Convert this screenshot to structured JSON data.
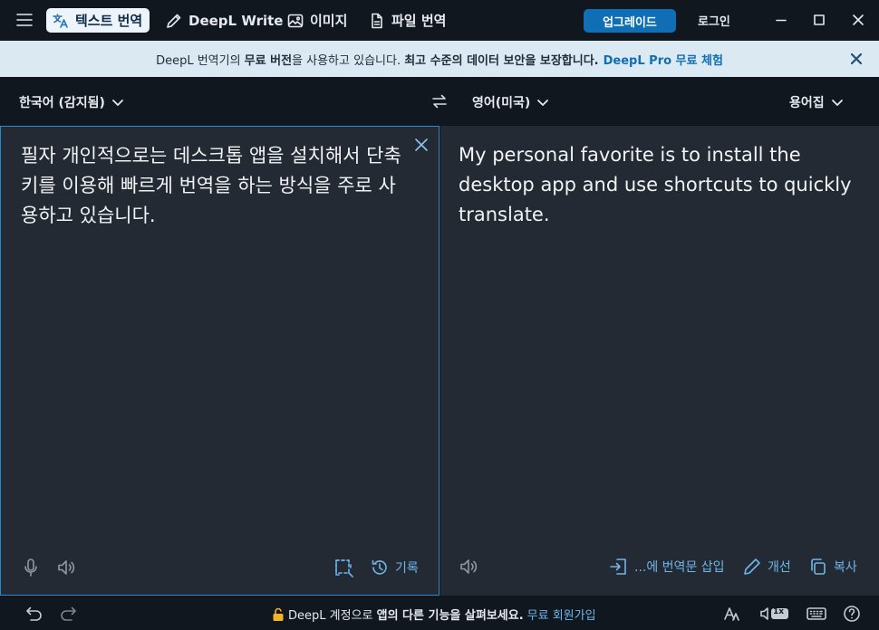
{
  "titlebar": {
    "tabs": [
      {
        "label": "텍스트 번역",
        "icon": "translate-icon",
        "active": true
      },
      {
        "label": "DeepL Write",
        "icon": "pen-icon"
      },
      {
        "label": "이미지",
        "icon": "image-icon"
      },
      {
        "label": "파일 번역",
        "icon": "file-icon"
      }
    ],
    "upgrade_label": "업그레이드",
    "login_label": "로그인"
  },
  "banner": {
    "text_1": "DeepL 번역기의 ",
    "bold_1": "무료 버전",
    "text_2": "을 사용하고 있습니다. ",
    "bold_2": "최고 수준의 데이터 보안을 보장합니다.",
    "link": "DeepL Pro 무료 체험"
  },
  "source": {
    "language": "한국어 (감지됨)",
    "text": "필자 개인적으로는 데스크톱 앱을 설치해서 단축키를 이용해 빠르게 번역을 하는 방식을 주로 사용하고 있습니다.",
    "history_label": "기록"
  },
  "target": {
    "language": "영어(미국)",
    "glossary_label": "용어집",
    "text": "My personal favorite is to install the desktop app and use shortcuts to quickly translate.",
    "insert_label": "...에 번역문 삽입",
    "improve_label": "개선",
    "copy_label": "복사"
  },
  "footer": {
    "msg_1": "DeepL 계정으로 ",
    "msg_bold": "앱의 다른 기능을 살펴보세요.",
    "link": "무료 회원가입",
    "speed_badge": "1x"
  },
  "colors": {
    "accent": "#0f6eb4",
    "panel": "#232a33",
    "chrome": "#11171f",
    "banner": "#dbe9f2",
    "link": "#6fb6e9"
  }
}
